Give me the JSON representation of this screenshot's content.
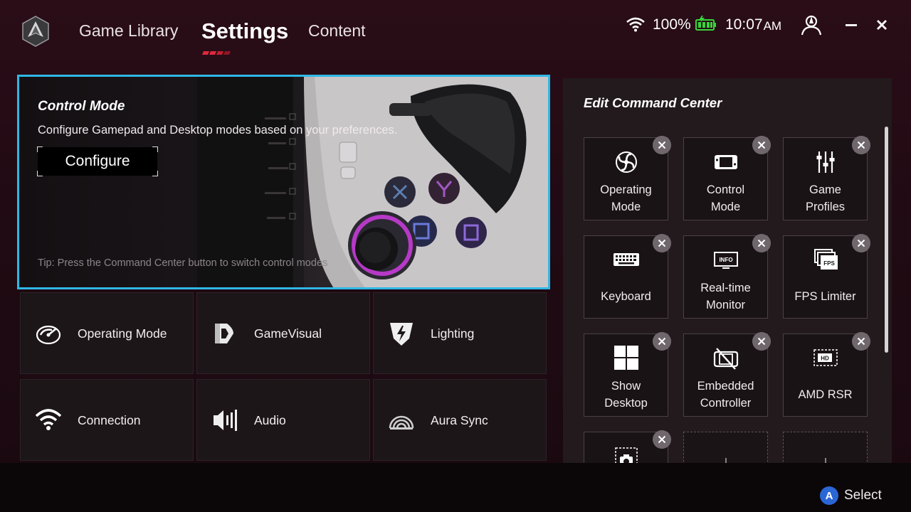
{
  "nav": {
    "tabs": [
      {
        "label": "Game Library"
      },
      {
        "label": "Settings"
      },
      {
        "label": "Content"
      }
    ],
    "active_tab": "Settings"
  },
  "status": {
    "battery_percent": "100%",
    "time": "10:07",
    "ampm": "AM"
  },
  "control_mode": {
    "title": "Control Mode",
    "description": "Configure Gamepad and Desktop modes based on your preferences.",
    "button": "Configure",
    "tip": "Tip: Press the Command Center button to switch control modes"
  },
  "settings_tiles": [
    {
      "label": "Operating Mode",
      "icon": "operating-mode-icon"
    },
    {
      "label": "GameVisual",
      "icon": "gamevisual-icon"
    },
    {
      "label": "Lighting",
      "icon": "lighting-icon"
    },
    {
      "label": "Connection",
      "icon": "wifi-icon"
    },
    {
      "label": "Audio",
      "icon": "audio-icon"
    },
    {
      "label": "Aura Sync",
      "icon": "aura-sync-icon"
    }
  ],
  "command_center": {
    "title": "Edit Command Center",
    "items": [
      {
        "line1": "Operating",
        "line2": "Mode",
        "icon": "fan-icon"
      },
      {
        "line1": "Control",
        "line2": "Mode",
        "icon": "handheld-icon"
      },
      {
        "line1": "Game",
        "line2": "Profiles",
        "icon": "sliders-icon"
      },
      {
        "line1": "Keyboard",
        "line2": "",
        "icon": "keyboard-icon"
      },
      {
        "line1": "Real-time",
        "line2": "Monitor",
        "icon": "monitor-icon"
      },
      {
        "line1": "FPS Limiter",
        "line2": "",
        "icon": "fps-icon"
      },
      {
        "line1": "Show",
        "line2": "Desktop",
        "icon": "windows-icon"
      },
      {
        "line1": "Embedded",
        "line2": "Controller",
        "icon": "controller-off-icon"
      },
      {
        "line1": "AMD RSR",
        "line2": "",
        "icon": "hd-icon"
      }
    ]
  },
  "footer": {
    "button_glyph": "A",
    "select_label": "Select"
  },
  "colors": {
    "accent_cyan": "#2fb8e6",
    "brand_red": "#e0283c",
    "battery_green": "#35d63a",
    "a_button_blue": "#2a66d6"
  }
}
